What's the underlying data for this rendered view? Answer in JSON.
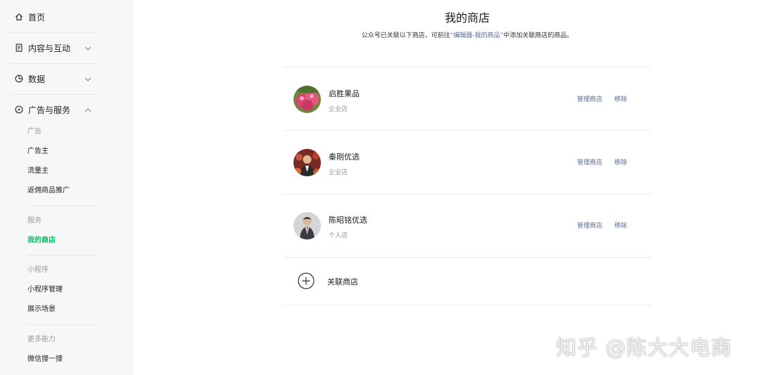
{
  "sidebar": {
    "nav": [
      {
        "label": "首页",
        "icon": "home-icon"
      },
      {
        "label": "内容与互动",
        "icon": "document-icon"
      },
      {
        "label": "数据",
        "icon": "pie-chart-icon"
      },
      {
        "label": "广告与服务",
        "icon": "compass-icon"
      }
    ],
    "groups": {
      "ads": {
        "title": "广告",
        "items": [
          "广告主",
          "流量主",
          "返佣商品推广"
        ]
      },
      "service": {
        "title": "服务",
        "items": [
          "我的商店"
        ]
      },
      "miniprogram": {
        "title": "小程序",
        "items": [
          "小程序管理",
          "展示场景"
        ]
      },
      "more": {
        "title": "更多能力",
        "items": [
          "微信搜一搜"
        ]
      }
    },
    "active_item": "我的商店",
    "accent_color": "#07c160"
  },
  "main": {
    "title": "我的商店",
    "description_prefix": "公众号已关联以下商店，可前往",
    "description_link": "“编辑器-我的商品”",
    "description_suffix": "中添加关联商店的商品。",
    "stores": [
      {
        "name": "启胜果品",
        "type": "企业店",
        "avatar": "fruit-avatar"
      },
      {
        "name": "秦刚优选",
        "type": "企业店",
        "avatar": "person-avatar"
      },
      {
        "name": "陈昭铭优选",
        "type": "个人店",
        "avatar": "person-avatar"
      }
    ],
    "manage_label": "管理商店",
    "remove_label": "移除",
    "add_label": "关联商店",
    "link_color": "#576b95"
  },
  "watermark": "知乎 @陈大大电商"
}
